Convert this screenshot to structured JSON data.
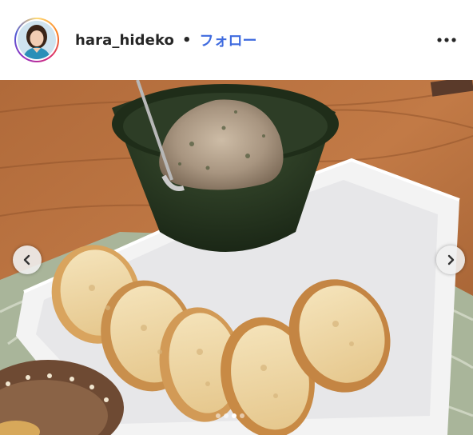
{
  "header": {
    "username": "hara_hideko",
    "separator": "•",
    "follow_label": "フォロー",
    "more_icon": "more-horizontal-icon"
  },
  "carousel": {
    "total_slides": 4,
    "active_slide": 3,
    "prev_icon": "chevron-left-icon",
    "next_icon": "chevron-right-icon"
  },
  "colors": {
    "follow": "#3f6bdf",
    "username": "#262626"
  }
}
